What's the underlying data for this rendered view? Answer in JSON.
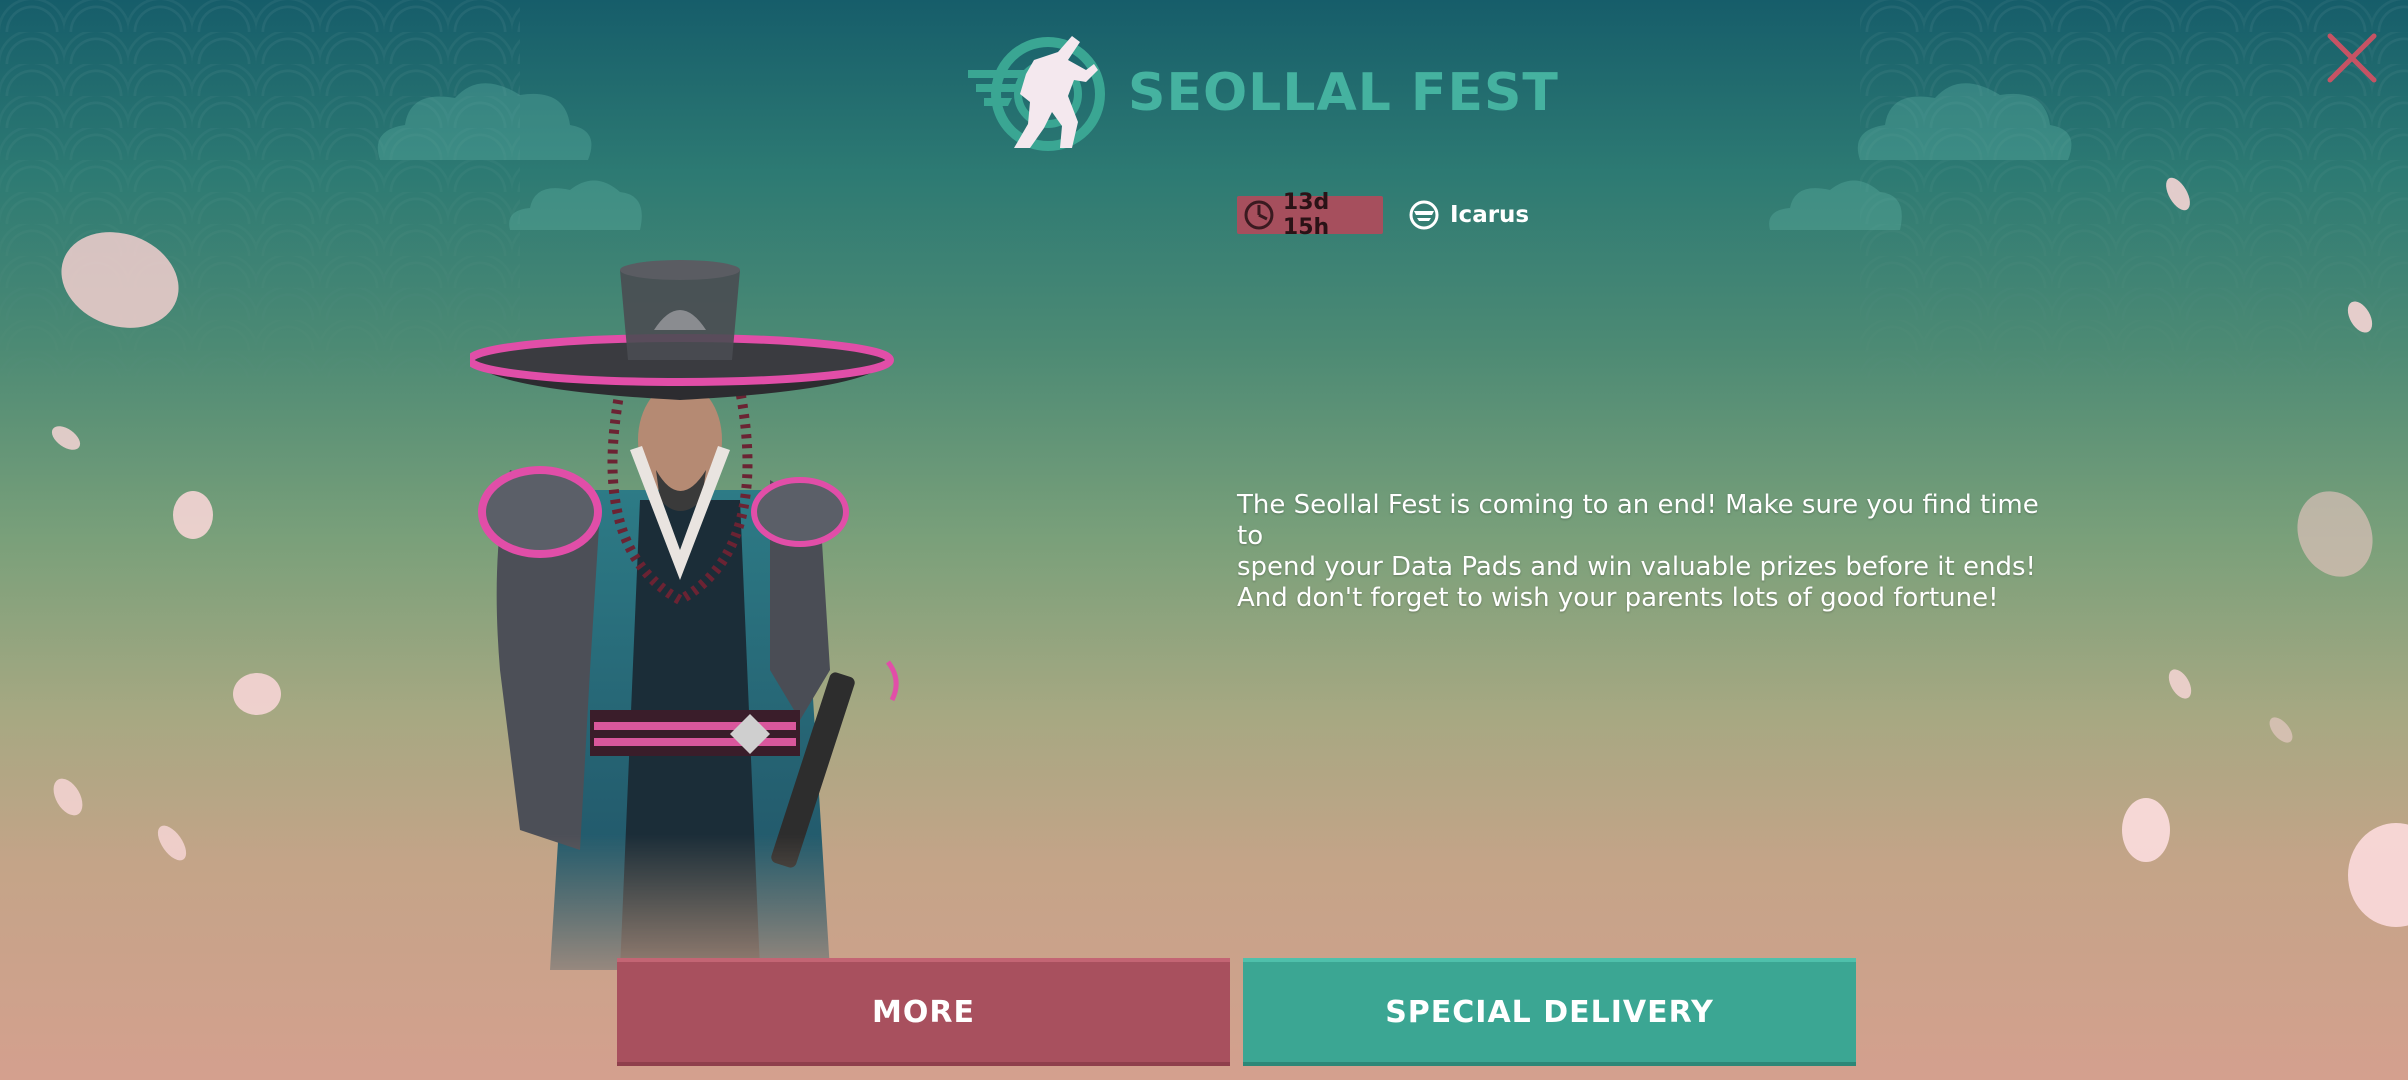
{
  "event": {
    "title": "SEOLLAL FEST",
    "logo_icon": "mech-silhouette-logo-icon"
  },
  "timer": {
    "icon": "clock-icon",
    "label": "13d 15h"
  },
  "tag": {
    "icon": "icarus-logo-icon",
    "label": "Icarus"
  },
  "description": {
    "line1": "The Seollal Fest is coming to an end! Make sure you find time to",
    "line2": "spend your Data Pads and win valuable prizes before it ends!",
    "line3": "And don't forget to wish your parents lots of good fortune!"
  },
  "buttons": {
    "more_label": "MORE",
    "special_label": "SPECIAL DELIVERY"
  },
  "close": {
    "icon": "close-icon"
  },
  "colors": {
    "title": "#45b2a0",
    "more_button": "#a8505e",
    "special_button": "#3ba693",
    "timer_badge": "#a64f5d",
    "close_icon": "#c65364"
  }
}
